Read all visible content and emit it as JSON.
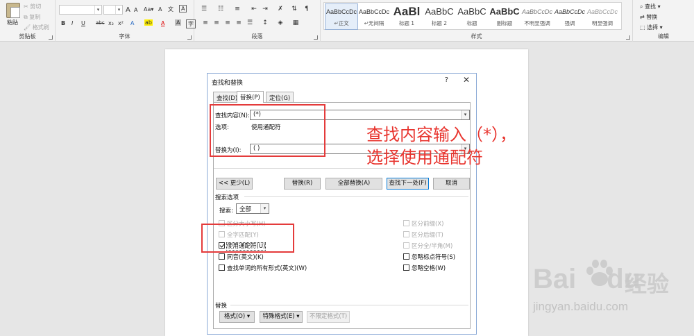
{
  "ribbon": {
    "clipboard": {
      "paste": "粘贴",
      "cut": "剪切",
      "copy": "复制",
      "format_painter": "格式刷",
      "group_label": "剪贴板"
    },
    "font": {
      "group_label": "字体",
      "buttons": [
        "B",
        "I",
        "U",
        "abc",
        "x₂",
        "x²",
        "A",
        "A",
        "A"
      ],
      "size_up": "A",
      "size_down": "A",
      "clear": "A",
      "wen": "文",
      "a_pinyin": "A"
    },
    "paragraph": {
      "group_label": "段落"
    },
    "styles": {
      "group_label": "样式",
      "items": [
        {
          "preview": "AaBbCcDc",
          "name": "↵正文"
        },
        {
          "preview": "AaBbCcDc",
          "name": "↵无间隔"
        },
        {
          "preview": "AaBl",
          "name": "标题 1"
        },
        {
          "preview": "AaBbC",
          "name": "标题 2"
        },
        {
          "preview": "AaBbC",
          "name": "标题"
        },
        {
          "preview": "AaBbC",
          "name": "副标题"
        },
        {
          "preview": "AaBbCcDc",
          "name": "不明显强调"
        },
        {
          "preview": "AaBbCcDc",
          "name": "强调"
        },
        {
          "preview": "AaBbCcDc",
          "name": "明显强调"
        }
      ]
    },
    "editing": {
      "find": "查找",
      "replace": "替换",
      "select": "选择",
      "group_label": "编辑"
    }
  },
  "dialog": {
    "title": "查找和替换",
    "help": "?",
    "close": "✕",
    "tabs": [
      "查找(D)",
      "替换(P)",
      "定位(G)"
    ],
    "find_label": "查找内容(N):",
    "find_value": "(*)",
    "options_label": "选项:",
    "options_value": "使用通配符",
    "replace_label": "替换为(I):",
    "replace_value": "( )",
    "buttons": {
      "less": "<< 更少(L)",
      "replace": "替换(R)",
      "replace_all": "全部替换(A)",
      "find_next": "查找下一处(F)",
      "cancel": "取消"
    },
    "search_options_label": "搜索选项",
    "search_label": "搜索:",
    "search_value": "全部",
    "left_checks": [
      {
        "label": "区分大小写(H)",
        "checked": false,
        "enabled": false
      },
      {
        "label": "全字匹配(Y)",
        "checked": false,
        "enabled": false
      },
      {
        "label": "使用通配符(U)",
        "checked": true,
        "enabled": true
      },
      {
        "label": "同音(英文)(K)",
        "checked": false,
        "enabled": true
      },
      {
        "label": "查找单词的所有形式(英文)(W)",
        "checked": false,
        "enabled": true
      }
    ],
    "right_checks": [
      {
        "label": "区分前缀(X)",
        "checked": false,
        "enabled": false
      },
      {
        "label": "区分后缀(T)",
        "checked": false,
        "enabled": false
      },
      {
        "label": "区分全/半角(M)",
        "checked": false,
        "enabled": false
      },
      {
        "label": "忽略标点符号(S)",
        "checked": false,
        "enabled": true
      },
      {
        "label": "忽略空格(W)",
        "checked": false,
        "enabled": true
      }
    ],
    "replace_section_label": "替换",
    "bottom_buttons": {
      "format": "格式(O) ▾",
      "special": "特殊格式(E) ▾",
      "no_format": "不限定格式(T)"
    }
  },
  "annotation": {
    "line1": "查找内容输入（*），",
    "line2": "选择使用通配符"
  },
  "watermark": {
    "logo_bai": "Bai",
    "logo_du": "du",
    "jingyan": "经验",
    "url": "jingyan.baidu.com"
  },
  "colors": {
    "annotation_red": "#e8352f",
    "dialog_border": "#8aa9d6"
  }
}
